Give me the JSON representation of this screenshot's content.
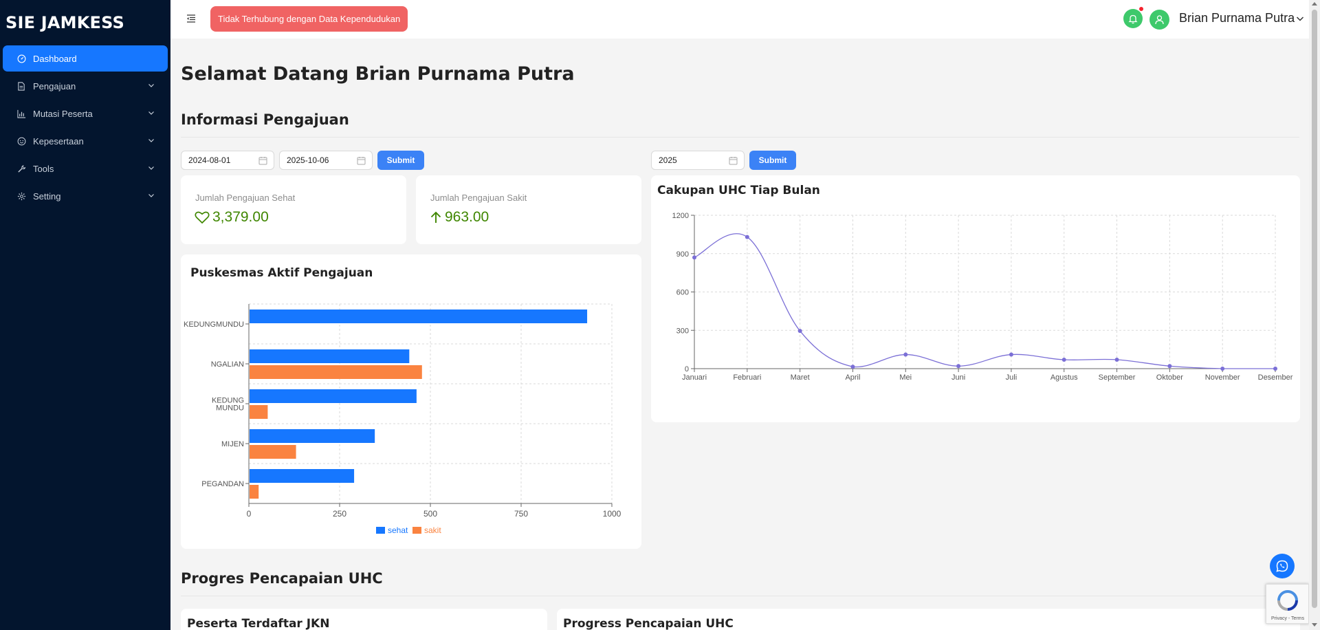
{
  "app": {
    "brand": "SIE JAMKESS"
  },
  "sidebar": {
    "items": [
      {
        "label": "Dashboard",
        "icon": "dashboard-icon",
        "active": true
      },
      {
        "label": "Pengajuan",
        "icon": "file-icon"
      },
      {
        "label": "Mutasi Peserta",
        "icon": "bar-chart-icon"
      },
      {
        "label": "Kepesertaan",
        "icon": "smile-icon"
      },
      {
        "label": "Tools",
        "icon": "tool-icon"
      },
      {
        "label": "Setting",
        "icon": "gear-icon"
      }
    ]
  },
  "header": {
    "alert": "Tidak Terhubung dengan Data Kependudukan",
    "user_name": "Brian Purnama Putra"
  },
  "main": {
    "welcome": "Selamat Datang Brian Purnama Putra",
    "section_pengajuan": "Informasi Pengajuan",
    "section_progres": "Progres Pencapaian UHC",
    "filters": {
      "start_date": "2024-08-01",
      "end_date": "2025-10-06",
      "year": "2025",
      "submit_label": "Submit"
    },
    "stats": {
      "sehat_label": "Jumlah Pengajuan Sehat",
      "sehat_value": "3,379.00",
      "sakit_label": "Jumlah Pengajuan Sakit",
      "sakit_value": "963.00"
    },
    "puskesmas_title": "Puskesmas Aktif Pengajuan",
    "uhc_title": "Cakupan UHC Tiap Bulan",
    "peserta_title": "Peserta Terdaftar JKN",
    "progress_title": "Progress Pencapaian UHC"
  },
  "recaptcha": {
    "text": "Privacy - Terms"
  },
  "colors": {
    "sidebar_bg": "#03152e",
    "primary": "#1677ff",
    "alert": "#f06363",
    "success": "#3f8600",
    "sehat": "#1677ff",
    "sakit": "#fa8340",
    "line": "#7b6fd6"
  },
  "chart_data": [
    {
      "type": "bar",
      "orientation": "horizontal",
      "title": "Puskesmas Aktif Pengajuan",
      "categories": [
        "KEDUNGMUNDU",
        "NGALIAN",
        "KEDUNG MUNDU",
        "MIJEN",
        "PEGANDAN"
      ],
      "category_display": [
        "KEDUNGMUNDU",
        "NGALIAN",
        "KEDUNG\nMUNDU",
        "MIJEN",
        "PEGANDAN"
      ],
      "series": [
        {
          "name": "sehat",
          "values": [
            930,
            440,
            460,
            345,
            288
          ]
        },
        {
          "name": "sakit",
          "values": [
            0,
            475,
            50,
            128,
            25
          ]
        }
      ],
      "xlim": [
        0,
        1000
      ],
      "xticks": [
        0,
        250,
        500,
        750,
        1000
      ],
      "legend": "bottom",
      "grid": true
    },
    {
      "type": "line",
      "title": "Cakupan UHC Tiap Bulan",
      "x": [
        "Januari",
        "Februari",
        "Maret",
        "April",
        "Mei",
        "Juni",
        "Juli",
        "Agustus",
        "September",
        "Oktober",
        "November",
        "Desember"
      ],
      "values": [
        870,
        1030,
        295,
        15,
        110,
        20,
        110,
        70,
        70,
        20,
        0,
        0
      ],
      "ylim": [
        0,
        1200
      ],
      "yticks": [
        0,
        300,
        600,
        900,
        1200
      ],
      "smooth": true,
      "grid": true
    }
  ]
}
